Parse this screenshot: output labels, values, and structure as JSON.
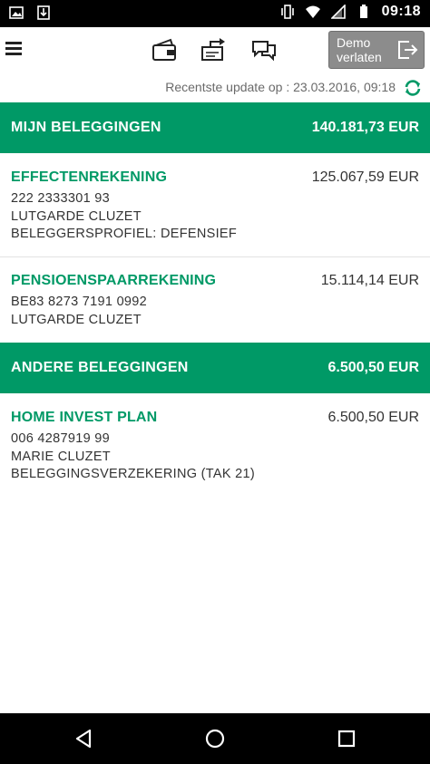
{
  "status_bar": {
    "time": "09:18"
  },
  "toolbar": {
    "demo_button_line1": "Demo",
    "demo_button_line2": "verlaten"
  },
  "update": {
    "text": "Recentste update op : 23.03.2016, 09:18"
  },
  "sections": [
    {
      "title": "MIJN BELEGGINGEN",
      "total": "140.181,73 EUR",
      "accounts": [
        {
          "name": "EFFECTENREKENING",
          "amount": "125.067,59 EUR",
          "line1": "222 2333301 93",
          "line2": "LUTGARDE CLUZET",
          "line3": "BELEGGERSPROFIEL: DEFENSIEF"
        },
        {
          "name": "PENSIOENSPAARREKENING",
          "amount": "15.114,14 EUR",
          "line1": "BE83 8273 7191 0992",
          "line2": "LUTGARDE CLUZET"
        }
      ]
    },
    {
      "title": "ANDERE BELEGGINGEN",
      "total": "6.500,50 EUR",
      "accounts": [
        {
          "name": "HOME INVEST PLAN",
          "amount": "6.500,50 EUR",
          "line1": "006 4287919 99",
          "line2": "MARIE CLUZET",
          "line3": "BELEGGINGSVERZEKERING (TAK 21)"
        }
      ]
    }
  ],
  "colors": {
    "brand_green": "#009966",
    "demo_button": "#8c8c8c"
  },
  "icons": [
    "image-icon",
    "download-icon",
    "vibrate-icon",
    "wifi-icon",
    "signal-icon",
    "battery-icon",
    "menu-icon",
    "wallet-icon",
    "transfer-icon",
    "chat-icon",
    "exit-icon",
    "refresh-icon",
    "back-icon",
    "home-icon",
    "recents-icon"
  ]
}
